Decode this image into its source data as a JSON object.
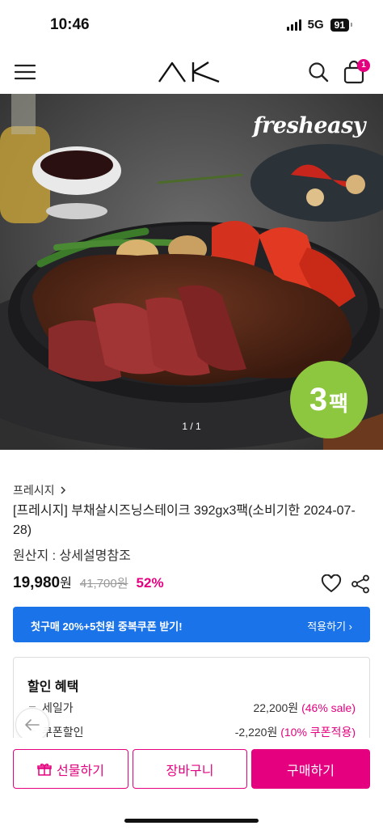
{
  "status_bar": {
    "time": "10:46",
    "network": "5G",
    "battery": "91"
  },
  "header": {
    "menu_icon": "hamburger-menu-icon",
    "logo": "AK",
    "search_icon": "search-icon",
    "cart_icon": "shopping-bag-icon",
    "cart_count": "1"
  },
  "hero": {
    "brand": "fresheasy",
    "pack_number": "3",
    "pack_unit": "팩",
    "pager": "1 / 1"
  },
  "product": {
    "breadcrumb": "프레시지",
    "title": "[프레시지] 부채살시즈닝스테이크 392gx3팩(소비기한 2024-07-28)",
    "origin": "원산지 : 상세설명참조",
    "price": "19,980",
    "price_unit": "원",
    "original_price": "41,700원",
    "discount_rate": "52%"
  },
  "coupon": {
    "text": "첫구매 20%+5천원 중복쿠폰 받기!",
    "action": "적용하기"
  },
  "discount": {
    "title": "할인 혜택",
    "rows": [
      {
        "label": "세일가",
        "amount": "22,200원",
        "note": "(46% sale)"
      },
      {
        "label": "쿠폰할인",
        "amount": "-2,220원",
        "note": "(10% 쿠폰적용)"
      }
    ]
  },
  "actions": {
    "gift": "선물하기",
    "cart": "장바구니",
    "buy": "구매하기"
  },
  "colors": {
    "accent": "#e4007f",
    "coupon_bg": "#1a73e8",
    "badge_green": "#8dc63f"
  }
}
